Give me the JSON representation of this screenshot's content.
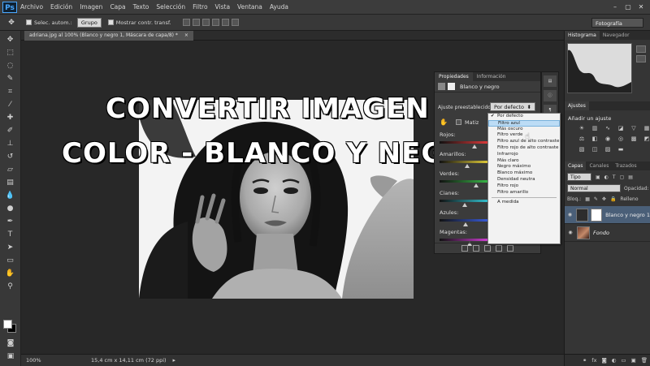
{
  "app": {
    "logo": "Ps",
    "menu": [
      "Archivo",
      "Edición",
      "Imagen",
      "Capa",
      "Texto",
      "Selección",
      "Filtro",
      "Vista",
      "Ventana",
      "Ayuda"
    ]
  },
  "options_bar": {
    "auto_select_label": "Selec. autom.:",
    "auto_select_value": "Grupo",
    "show_transform_label": "Mostrar contr. transf.",
    "workspace": "Fotografía"
  },
  "document": {
    "tab_title": "adriana.jpg al 100% (Blanco y negro 1, Máscara de capa/8) *",
    "tab_close": "×",
    "zoom": "100%",
    "doc_size": "15,4 cm x 14,11 cm (72 ppi)"
  },
  "overlay": {
    "line1": "CONVERTIR IMAGEN",
    "line2": "COLOR - BLANCO Y NEGRO"
  },
  "properties": {
    "tabs": [
      "Propiedades",
      "Información"
    ],
    "title": "Blanco y negro",
    "preset_label": "Ajuste preestablecido:",
    "preset_value": "Por defecto",
    "tint_label": "Matiz",
    "sliders": [
      "Rojos:",
      "Amarillos:",
      "Verdes:",
      "Cianes:",
      "Azules:",
      "Magentas:"
    ],
    "slider_colors": [
      "#e53b3b",
      "#e8d23a",
      "#3bbf4a",
      "#35c7d6",
      "#3a5ee0",
      "#d43fd8"
    ],
    "slider_levels": [
      0.7,
      0.55,
      0.72,
      0.5,
      0.52,
      0.6
    ]
  },
  "preset_dropdown": {
    "items": [
      "Por defecto",
      "Filtro azul",
      "Más oscuro",
      "Filtro verde",
      "Filtro azul de alto contraste",
      "Filtro rojo de alto contraste",
      "Infrarrojo",
      "Más claro",
      "Negro máximo",
      "Blanco máximo",
      "Densidad neutra",
      "Filtro rojo",
      "Filtro amarillo"
    ],
    "checked": "Por defecto",
    "highlighted": "Filtro azul",
    "custom": "A medida"
  },
  "right_panels": {
    "top_tabs": [
      "Histograma",
      "Navegador"
    ],
    "adjust_tab": "Ajustes",
    "adjust_title": "Añadir un ajuste",
    "layer_tabs": [
      "Capas",
      "Canales",
      "Trazados"
    ],
    "filter_kind": "Tipo",
    "blend_mode": "Normal",
    "opacity_label": "Opacidad:",
    "lock_label": "Bloq.:",
    "fill_label": "Relleno",
    "layers": [
      {
        "name": "Blanco y negro 1",
        "selected": true
      },
      {
        "name": "Fondo",
        "selected": false
      }
    ],
    "footer_fx": "fx"
  }
}
